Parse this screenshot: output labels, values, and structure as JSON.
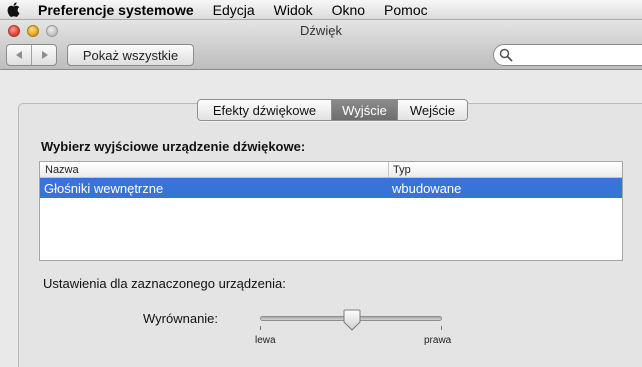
{
  "menubar": {
    "app_name": "Preferencje systemowe",
    "items": [
      "Edycja",
      "Widok",
      "Okno",
      "Pomoc"
    ]
  },
  "window": {
    "title": "Dźwięk"
  },
  "toolbar": {
    "show_all_label": "Pokaż wszystkie",
    "search_placeholder": ""
  },
  "tabs": [
    {
      "label": "Efekty dźwiękowe",
      "selected": false
    },
    {
      "label": "Wyjście",
      "selected": true
    },
    {
      "label": "Wejście",
      "selected": false
    }
  ],
  "output": {
    "heading": "Wybierz wyjściowe urządzenie dźwiękowe:",
    "columns": [
      "Nazwa",
      "Typ"
    ],
    "rows": [
      {
        "name": "Głośniki wewnętrzne",
        "type": "wbudowane",
        "selected": true
      }
    ]
  },
  "device_settings": {
    "heading": "Ustawienia dla zaznaczonego urządzenia:",
    "balance": {
      "label": "Wyrównanie:",
      "min_label": "lewa",
      "max_label": "prawa",
      "value": 0.5
    }
  },
  "colors": {
    "selection": "#3874d7",
    "selected_tab": "#7c7c7c"
  }
}
